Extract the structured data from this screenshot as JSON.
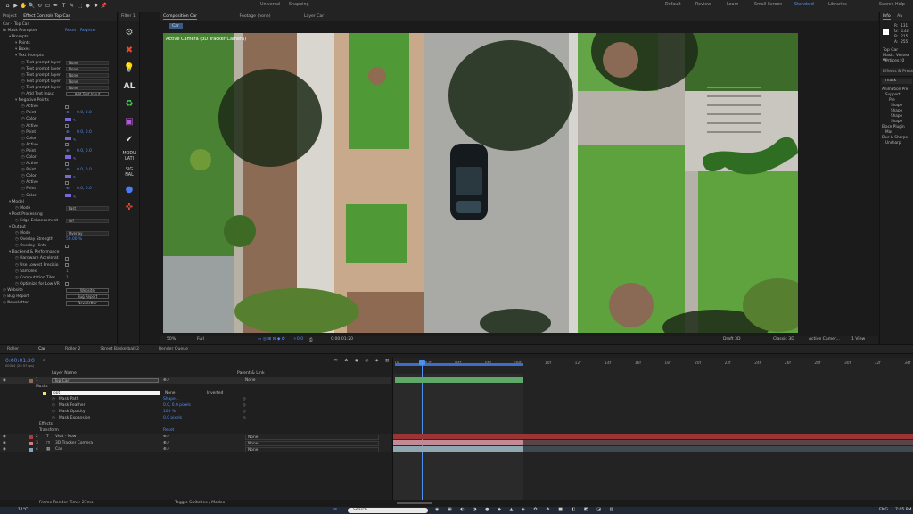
{
  "toolbar": {
    "tools": [
      "⌂",
      "▶",
      "✋",
      "🔍",
      "↻",
      "▭",
      "✒",
      "T",
      "✎",
      "⬚",
      "◆",
      "✸",
      "📌"
    ],
    "universal": "Universal",
    "snapping": "Snapping",
    "workspaces": [
      "Default",
      "Review",
      "Learn",
      "Small Screen",
      "Standard",
      "Libraries"
    ],
    "active_workspace": "Standard",
    "search": "Search Help"
  },
  "effects_panel": {
    "tabs": [
      "Project",
      "Effect Controls Top Car"
    ],
    "filter_tab": "Filter 1",
    "layer_path": "Car • Top Car",
    "effect_name": "Mask Prompter",
    "reset": "Reset",
    "register": "Register",
    "lines": [
      {
        "indent": 1,
        "label": "Prompts"
      },
      {
        "indent": 2,
        "label": "Points"
      },
      {
        "indent": 2,
        "label": "Boxes"
      },
      {
        "indent": 2,
        "label": "Text Prompts"
      },
      {
        "indent": 3,
        "label": "Text prompt layer",
        "dd": "None"
      },
      {
        "indent": 3,
        "label": "Text prompt layer",
        "dd": "None"
      },
      {
        "indent": 3,
        "label": "Text prompt layer",
        "dd": "None"
      },
      {
        "indent": 3,
        "label": "Text prompt layer",
        "dd": "None"
      },
      {
        "indent": 3,
        "label": "Text prompt layer",
        "dd": "None"
      },
      {
        "indent": 3,
        "label": "Add Text Input",
        "btn": "Add Text Input"
      },
      {
        "indent": 2,
        "label": "Negative Points"
      },
      {
        "indent": 3,
        "label": "Active",
        "chk": true
      },
      {
        "indent": 3,
        "label": "Point",
        "val": "0.0, 0.0"
      },
      {
        "indent": 3,
        "label": "Color",
        "swatch": true
      },
      {
        "indent": 3,
        "label": "Active",
        "chk": true
      },
      {
        "indent": 3,
        "label": "Point",
        "val": "0.0, 0.0"
      },
      {
        "indent": 3,
        "label": "Color",
        "swatch": true
      },
      {
        "indent": 3,
        "label": "Active",
        "chk": true
      },
      {
        "indent": 3,
        "label": "Point",
        "val": "0.0, 0.0"
      },
      {
        "indent": 3,
        "label": "Color",
        "swatch": true
      },
      {
        "indent": 3,
        "label": "Active",
        "chk": true
      },
      {
        "indent": 3,
        "label": "Point",
        "val": "0.0, 0.0"
      },
      {
        "indent": 3,
        "label": "Color",
        "swatch": true
      },
      {
        "indent": 3,
        "label": "Active",
        "chk": true
      },
      {
        "indent": 3,
        "label": "Point",
        "val": "0.0, 0.0"
      },
      {
        "indent": 3,
        "label": "Color",
        "swatch": true
      },
      {
        "indent": 1,
        "label": "Model"
      },
      {
        "indent": 2,
        "label": "Mode",
        "dd": "Fast"
      },
      {
        "indent": 1,
        "label": "Post Processing"
      },
      {
        "indent": 2,
        "label": "Edge Enhancement",
        "dd": "Off"
      },
      {
        "indent": 1,
        "label": "Output"
      },
      {
        "indent": 2,
        "label": "Mode",
        "dd": "Overlay"
      },
      {
        "indent": 2,
        "label": "Overlay Strength",
        "val": "50.00 %"
      },
      {
        "indent": 2,
        "label": "Overlay Hints",
        "chk": true
      },
      {
        "indent": 1,
        "label": "Backend & Performance"
      },
      {
        "indent": 2,
        "label": "Hardware Accelerat",
        "chk": true
      },
      {
        "indent": 2,
        "label": "Use Lowest Precisio",
        "chk": true
      },
      {
        "indent": 2,
        "label": "Samples",
        "val": "1"
      },
      {
        "indent": 2,
        "label": "Computation Tiles",
        "val": "1"
      },
      {
        "indent": 2,
        "label": "Optimize for Low VR",
        "chk": true
      },
      {
        "indent": 0,
        "label": "Website",
        "btn": "Website"
      },
      {
        "indent": 0,
        "label": "Bug Report",
        "btn": "Bug Report"
      },
      {
        "indent": 0,
        "label": "Newsletter",
        "btn": "Newsletter"
      }
    ]
  },
  "toolstrip": {
    "icons": [
      "⚙",
      "✖",
      "💡"
    ],
    "al": "AL",
    "icons2": [
      "♻",
      "▣",
      "✔"
    ],
    "modulate": [
      "MODU",
      "LATI"
    ],
    "signal": [
      "SIG",
      "NAL"
    ],
    "icons3": [
      "●",
      "✜"
    ]
  },
  "composition": {
    "tabs": [
      "Composition Car",
      "Footage (none)",
      "Layer Car"
    ],
    "breadcrumb": "Car",
    "camera_label": "Active Camera (3D Tracker Camera)",
    "bottom": {
      "zoom": "50%",
      "quality": "Full",
      "timecode": "0:00:01:20",
      "renderer": "Draft 3D",
      "renderer2": "Classic 3D",
      "view": "Active Camer...",
      "views": "1 View",
      "exposure": "+0.0"
    }
  },
  "right_panel": {
    "tabs": [
      "Info",
      "Au"
    ],
    "rgb": [
      {
        "ch": "R:",
        "v": "131"
      },
      {
        "ch": "G:",
        "v": "133"
      },
      {
        "ch": "B:",
        "v": "215"
      },
      {
        "ch": "A:",
        "v": "255"
      }
    ],
    "layer": "Top Car",
    "mask_info": "Mask: Vertex en",
    "vertices": "Vertices: 0",
    "effects_title": "Effects & Presets",
    "search": "mask",
    "tree": [
      "Animation Pre",
      "Support",
      "Pre",
      "Shape",
      "Shape",
      "Shape",
      "Shape",
      "Blace Plugin",
      "Mas",
      "Blur & Sharpe",
      "Unsharp"
    ]
  },
  "timeline": {
    "tabs": [
      "Roller",
      "Car",
      "Roller 2",
      "Street Basketball 2",
      "Render Queue"
    ],
    "active_tab": "Car",
    "timecode": "0:00:01:20",
    "fps": "00044 (29.97 fps)",
    "col_layer_name": "Layer Name",
    "col_parent": "Parent & Link",
    "ticks": [
      "0s",
      "02f",
      "04f",
      "06f",
      "08f",
      "10f",
      "12f",
      "14f",
      "16f",
      "18f",
      "20f",
      "22f",
      "24f",
      "26f",
      "28f",
      "30f",
      "32f",
      "34f"
    ],
    "layers": [
      {
        "num": "1",
        "name": "Top Car",
        "parent": "None",
        "color": "#8e6a5c",
        "selected": true
      },
      {
        "num": "2",
        "name": "Visit - Now",
        "parent": "None",
        "color": "#b23b3b",
        "type": "T"
      },
      {
        "num": "3",
        "name": "3D Tracker Camera",
        "parent": "None",
        "color": "#d27d8e",
        "type": "cam"
      },
      {
        "num": "4",
        "name": "Car",
        "parent": "None",
        "color": "#7fa9b8",
        "type": "footage"
      }
    ],
    "masks_label": "Masks",
    "mask_name": "opt",
    "mask_mode": "None",
    "inverted": "Inverted",
    "mask_props": [
      {
        "name": "Mask Path",
        "val": "Shape..."
      },
      {
        "name": "Mask Feather",
        "val": "0.0, 0.0 pixels"
      },
      {
        "name": "Mask Opacity",
        "val": "100 %"
      },
      {
        "name": "Mask Expansion",
        "val": "0.0 pixels"
      }
    ],
    "effects_label": "Effects",
    "transform_label": "Transform",
    "reset": "Reset"
  },
  "status": {
    "frame_render": "Frame Render Time: 27ms",
    "toggle": "Toggle Switches / Modes"
  },
  "taskbar": {
    "weather": "11°C",
    "search": "Search",
    "lang": "ENG",
    "time": "7:05 PM"
  }
}
